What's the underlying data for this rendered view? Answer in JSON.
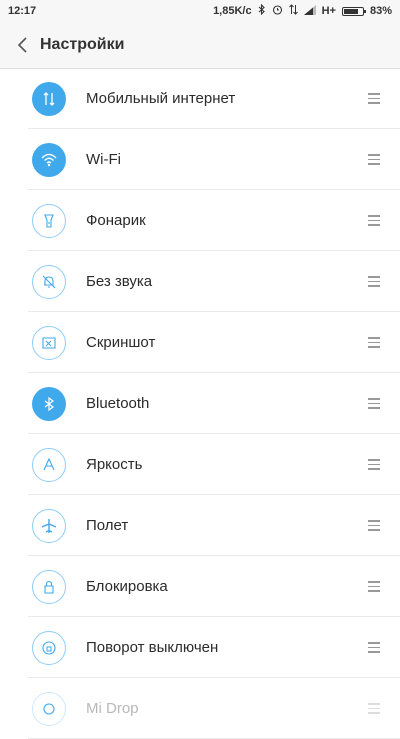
{
  "status_bar": {
    "time": "12:17",
    "net_speed": "1,85K/c",
    "network_type": "H+",
    "battery_text": "83%",
    "battery_level": 0.83,
    "icons": [
      "bluetooth-icon",
      "alarm-icon",
      "data-arrows-icon",
      "signal-icon",
      "battery-icon"
    ]
  },
  "header": {
    "title": "Настройки",
    "back_icon": "chevron-left-icon"
  },
  "items": [
    {
      "label": "Мобильный интернет",
      "icon": "mobile-data-icon",
      "enabled": true
    },
    {
      "label": "Wi-Fi",
      "icon": "wifi-icon",
      "enabled": true
    },
    {
      "label": "Фонарик",
      "icon": "flashlight-icon",
      "enabled": false
    },
    {
      "label": "Без звука",
      "icon": "mute-bell-icon",
      "enabled": false
    },
    {
      "label": "Скриншот",
      "icon": "screenshot-icon",
      "enabled": false
    },
    {
      "label": "Bluetooth",
      "icon": "bluetooth-icon",
      "enabled": true
    },
    {
      "label": "Яркость",
      "icon": "brightness-icon",
      "enabled": false
    },
    {
      "label": "Полет",
      "icon": "airplane-icon",
      "enabled": false
    },
    {
      "label": "Блокировка",
      "icon": "lock-icon",
      "enabled": false
    },
    {
      "label": "Поворот выключен",
      "icon": "rotation-lock-icon",
      "enabled": false
    },
    {
      "label": "Mi Drop",
      "icon": "mi-drop-icon",
      "enabled": false
    }
  ],
  "colors": {
    "accent": "#3fa9ec",
    "accent_light": "#8fcdf4",
    "background": "#ffffff",
    "header_bg": "#f7f7f7"
  }
}
